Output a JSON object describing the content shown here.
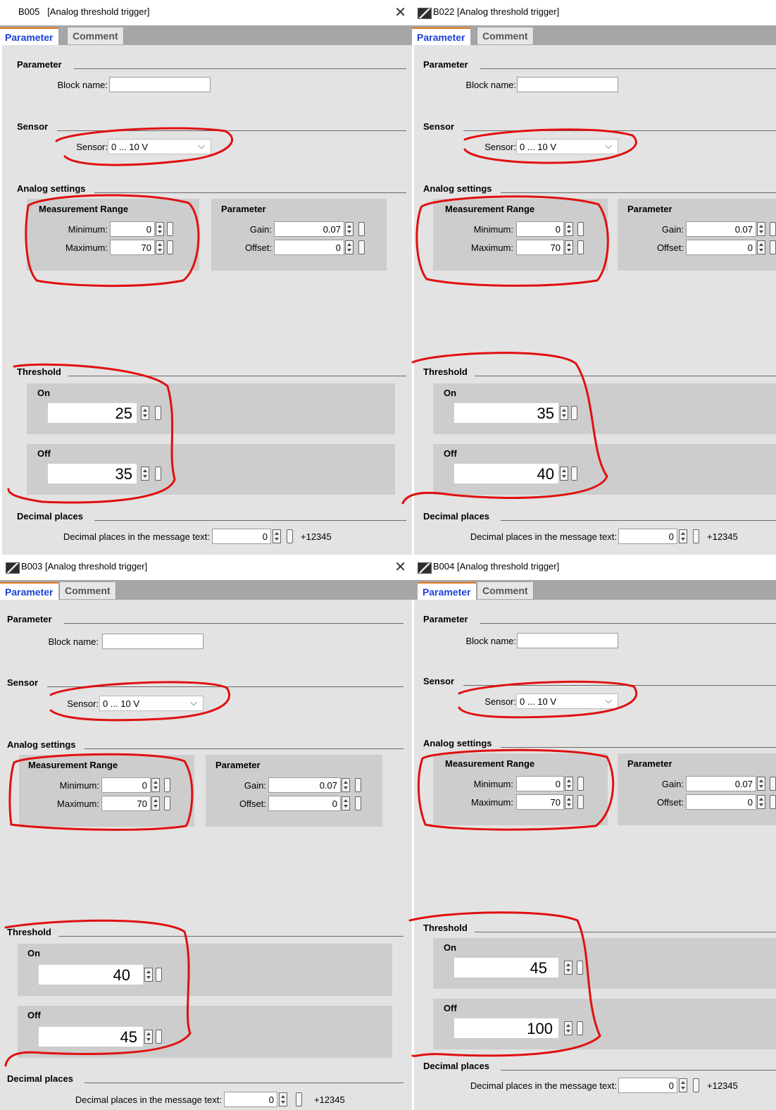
{
  "panels": [
    {
      "title": "B005   [Analog threshold trigger]",
      "tabs": [
        "Parameter",
        "Comment"
      ],
      "parameter_section": "Parameter",
      "block_name_label": "Block name:",
      "block_name_value": "",
      "sensor_section": "Sensor",
      "sensor_label": "Sensor:",
      "sensor_value": "0 ... 10 V",
      "analog_section": "Analog settings",
      "range_group": "Measurement Range",
      "min_label": "Minimum:",
      "min_value": "0",
      "max_label": "Maximum:",
      "max_value": "70",
      "param_group": "Parameter",
      "gain_label": "Gain:",
      "gain_value": "0.07",
      "offset_label": "Offset:",
      "offset_value": "0",
      "threshold_section": "Threshold",
      "on_label": "On",
      "on_value": "25",
      "off_label": "Off",
      "off_value": "35",
      "decimal_section": "Decimal places",
      "decimal_label": "Decimal places in the message text:",
      "decimal_value": "0",
      "decimal_preview": "+12345"
    },
    {
      "title": "B022 [Analog threshold trigger]",
      "tabs": [
        "Parameter",
        "Comment"
      ],
      "parameter_section": "Parameter",
      "block_name_label": "Block name:",
      "block_name_value": "",
      "sensor_section": "Sensor",
      "sensor_label": "Sensor:",
      "sensor_value": "0 ... 10 V",
      "analog_section": "Analog settings",
      "range_group": "Measurement Range",
      "min_label": "Minimum:",
      "min_value": "0",
      "max_label": "Maximum:",
      "max_value": "70",
      "param_group": "Parameter",
      "gain_label": "Gain:",
      "gain_value": "0.07",
      "offset_label": "Offset:",
      "offset_value": "0",
      "threshold_section": "Threshold",
      "on_label": "On",
      "on_value": "35",
      "off_label": "Off",
      "off_value": "40",
      "decimal_section": "Decimal places",
      "decimal_label": "Decimal places in the message text:",
      "decimal_value": "0",
      "decimal_preview": "+12345"
    },
    {
      "title": "B003 [Analog threshold trigger]",
      "tabs": [
        "Parameter",
        "Comment"
      ],
      "parameter_section": "Parameter",
      "block_name_label": "Block name:",
      "block_name_value": "",
      "sensor_section": "Sensor",
      "sensor_label": "Sensor:",
      "sensor_value": "0 ... 10 V",
      "analog_section": "Analog settings",
      "range_group": "Measurement Range",
      "min_label": "Minimum:",
      "min_value": "0",
      "max_label": "Maximum:",
      "max_value": "70",
      "param_group": "Parameter",
      "gain_label": "Gain:",
      "gain_value": "0.07",
      "offset_label": "Offset:",
      "offset_value": "0",
      "threshold_section": "Threshold",
      "on_label": "On",
      "on_value": "40",
      "off_label": "Off",
      "off_value": "45",
      "decimal_section": "Decimal places",
      "decimal_label": "Decimal places in the message text:",
      "decimal_value": "0",
      "decimal_preview": "+12345"
    },
    {
      "title": "B004 [Analog threshold trigger]",
      "tabs": [
        "Parameter",
        "Comment"
      ],
      "parameter_section": "Parameter",
      "block_name_label": "Block name:",
      "block_name_value": "",
      "sensor_section": "Sensor",
      "sensor_label": "Sensor:",
      "sensor_value": "0 ... 10 V",
      "analog_section": "Analog settings",
      "range_group": "Measurement Range",
      "min_label": "Minimum:",
      "min_value": "0",
      "max_label": "Maximum:",
      "max_value": "70",
      "param_group": "Parameter",
      "gain_label": "Gain:",
      "gain_value": "0.07",
      "offset_label": "Offset:",
      "offset_value": "0",
      "threshold_section": "Threshold",
      "on_label": "On",
      "on_value": "45",
      "off_label": "Off",
      "off_value": "100",
      "decimal_section": "Decimal places",
      "decimal_label": "Decimal places in the message text:",
      "decimal_value": "0",
      "decimal_preview": "+12345"
    }
  ],
  "icons": {
    "window": "block-icon",
    "close": "close-icon",
    "spinner": "spinner-icon",
    "param_ref": "brace-icon",
    "dropdown": "chevron-down-icon"
  },
  "colors": {
    "active_tab_text": "#1a41d6",
    "tab_accent": "#e77b1e",
    "annotation": "#e01010",
    "panel_bg": "#e3e3e3",
    "group_bg": "#cdcdcd"
  }
}
